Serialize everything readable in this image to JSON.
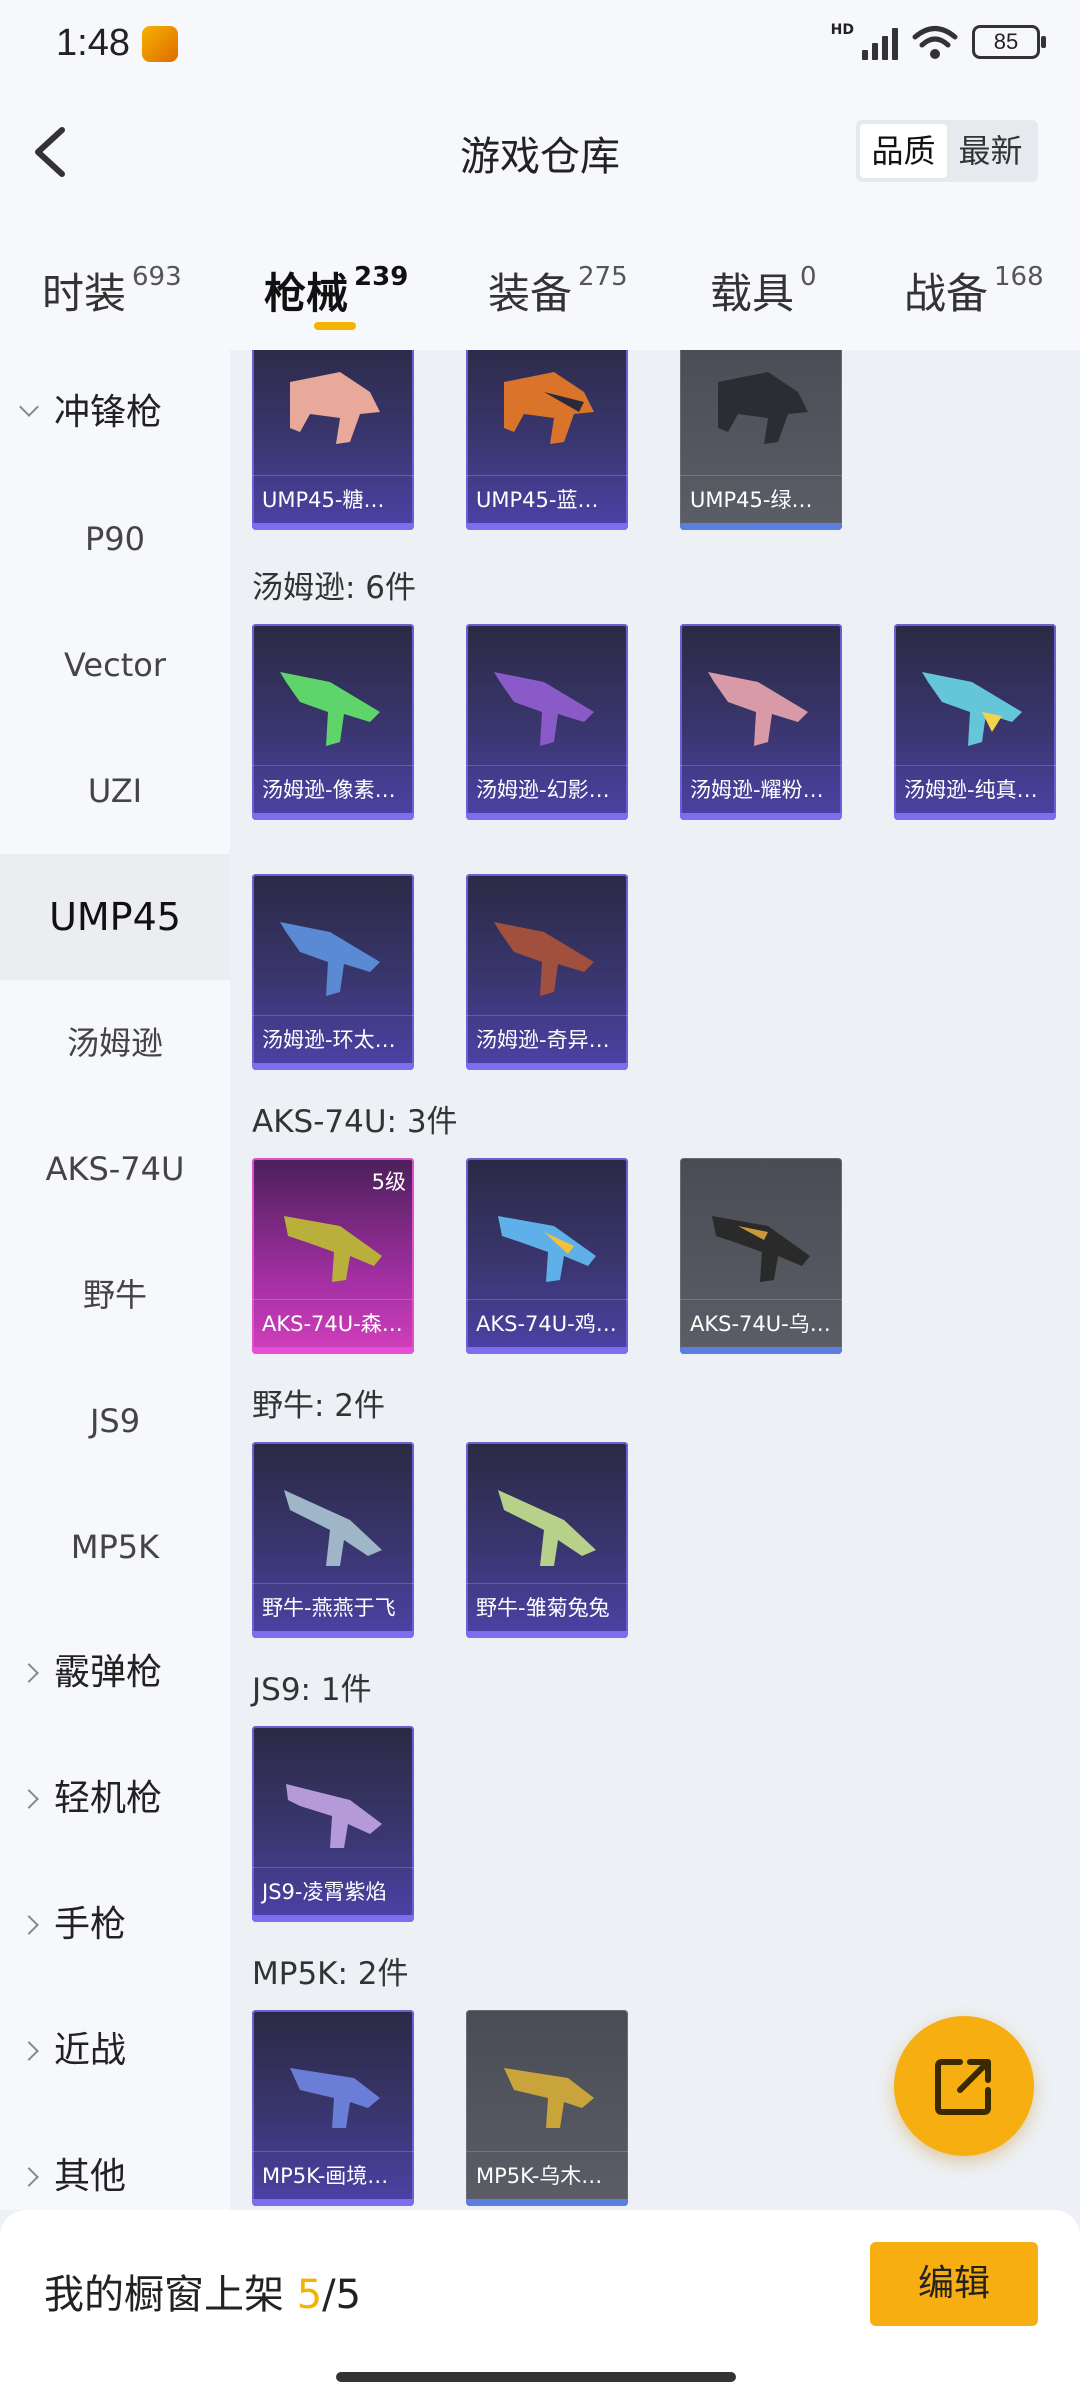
{
  "status": {
    "time": "1:48",
    "battery": "85"
  },
  "header": {
    "title": "游戏仓库",
    "sort": [
      "品质",
      "最新"
    ]
  },
  "tabs": [
    {
      "label": "时装",
      "count": "693"
    },
    {
      "label": "枪械",
      "count": "239"
    },
    {
      "label": "装备",
      "count": "275"
    },
    {
      "label": "载具",
      "count": "0"
    },
    {
      "label": "战备",
      "count": "168"
    }
  ],
  "sidebar": {
    "group_open": "冲锋枪",
    "items": [
      "P90",
      "Vector",
      "UZI",
      "UMP45",
      "汤姆逊",
      "AKS-74U",
      "野牛",
      "JS9",
      "MP5K"
    ],
    "groups": [
      "霰弹枪",
      "轻机枪",
      "手枪",
      "近战",
      "其他"
    ]
  },
  "sections": {
    "thompson": "汤姆逊: 6件",
    "aks": "AKS-74U: 3件",
    "bison": "野牛: 2件",
    "js9": "JS9: 1件",
    "mp5k": "MP5K: 2件"
  },
  "cards": {
    "ump1": "UMP45-糖…",
    "ump2": "UMP45-蓝…",
    "ump3": "UMP45-绿…",
    "t1": "汤姆逊-像素…",
    "t2": "汤姆逊-幻影…",
    "t3": "汤姆逊-耀粉…",
    "t4": "汤姆逊-纯真…",
    "t5": "汤姆逊-环太…",
    "t6": "汤姆逊-奇异…",
    "a1": "AKS-74U-森…",
    "a1_level": "5级",
    "a2": "AKS-74U-鸡…",
    "a3": "AKS-74U-乌…",
    "b1": "野牛-燕燕于飞",
    "b2": "野牛-雏菊兔兔",
    "j1": "JS9-凌霄紫焰",
    "m1": "MP5K-画境…",
    "m2": "MP5K-乌木…"
  },
  "bottom": {
    "prefix": "我的橱窗上架 ",
    "current": "5",
    "suffix": "/5",
    "edit": "编辑"
  },
  "colors": {
    "accent": "#f5b301",
    "card_purple": "#4d42a8",
    "card_pink": "#d33fbd",
    "card_grey": "#5c5e67"
  }
}
